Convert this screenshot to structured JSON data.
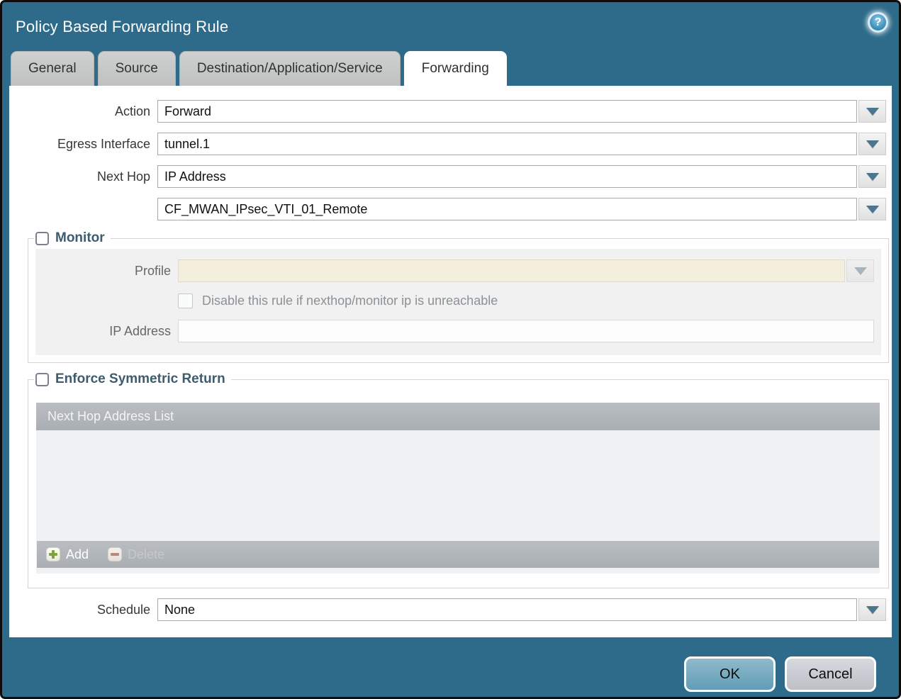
{
  "window": {
    "title": "Policy Based Forwarding Rule",
    "help_icon": "?"
  },
  "tabs": [
    {
      "label": "General",
      "active": false
    },
    {
      "label": "Source",
      "active": false
    },
    {
      "label": "Destination/Application/Service",
      "active": false
    },
    {
      "label": "Forwarding",
      "active": true
    }
  ],
  "form": {
    "action": {
      "label": "Action",
      "value": "Forward"
    },
    "egress_interface": {
      "label": "Egress Interface",
      "value": "tunnel.1"
    },
    "next_hop": {
      "label": "Next Hop",
      "value": "IP Address"
    },
    "next_hop_address": {
      "value": "CF_MWAN_IPsec_VTI_01_Remote"
    },
    "schedule": {
      "label": "Schedule",
      "value": "None"
    }
  },
  "monitor": {
    "label": "Monitor",
    "checked": false,
    "profile": {
      "label": "Profile",
      "value": "",
      "disabled": true
    },
    "disable_rule": {
      "label": "Disable this rule if nexthop/monitor ip is unreachable",
      "checked": false,
      "disabled": true
    },
    "ip_address": {
      "label": "IP Address",
      "value": "",
      "disabled": true
    }
  },
  "symmetric_return": {
    "label": "Enforce Symmetric Return",
    "checked": false,
    "table": {
      "header": "Next Hop Address List",
      "rows": [],
      "add_label": "Add",
      "delete_label": "Delete",
      "delete_disabled": true
    }
  },
  "footer": {
    "ok_label": "OK",
    "cancel_label": "Cancel"
  },
  "colors": {
    "dialog_background": "#2e6b8a",
    "outer_border": "#0d0d0d",
    "active_tab": "#ffffff",
    "inactive_tab": "#c5c6c6",
    "legend_text": "#3d5c6e",
    "disabled_field": "#f4eedc",
    "table_bar": "#aeb2b6",
    "table_body": "#f0f1f2",
    "ok_button": "#6ba3bc",
    "cancel_button": "#c6c9cf",
    "dropdown_arrow": "#4d758e",
    "add_icon_green": "#7ba33e",
    "delete_icon_red": "#b48a80"
  }
}
